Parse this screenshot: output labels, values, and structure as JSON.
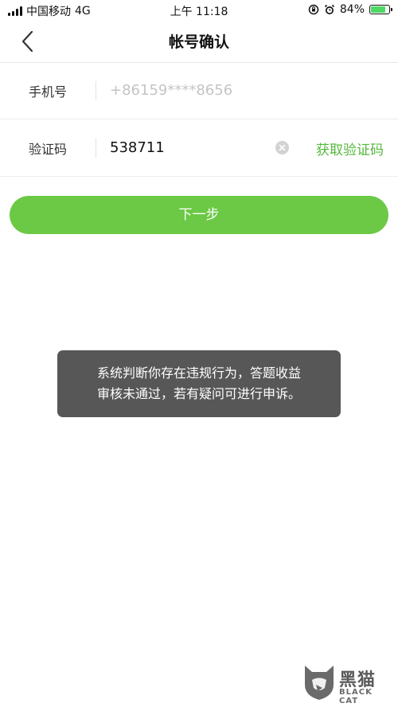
{
  "status_bar": {
    "carrier": "中国移动",
    "network": "4G",
    "time": "上午 11:18",
    "battery_percent_text": "84%",
    "battery_level": 0.84
  },
  "nav": {
    "title": "帐号确认"
  },
  "form": {
    "phone_label": "手机号",
    "phone_placeholder": "+86159****8656",
    "code_label": "验证码",
    "code_value": "538711",
    "get_code_label": "获取验证码"
  },
  "next_button": {
    "label": "下一步"
  },
  "toast": {
    "line1": "系统判断你存在违规行为，答题收益",
    "line2": "审核未通过，若有疑问可进行申诉。"
  },
  "watermark": {
    "title": "黑猫",
    "subtitle": "BLACK CAT"
  },
  "colors": {
    "accent_green": "#6cc946",
    "link_green": "#56b83c",
    "toast_bg": "#575757"
  }
}
